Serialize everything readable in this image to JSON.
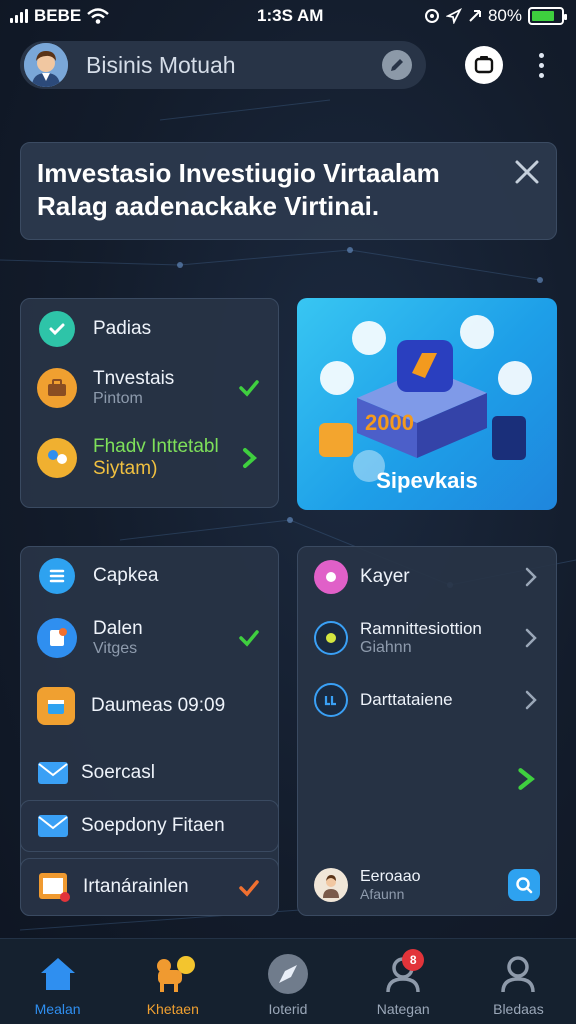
{
  "status_bar": {
    "carrier": "BEBE",
    "time": "1:3S AM",
    "battery": "80%",
    "battery_level": 0.8
  },
  "profile": {
    "name": "Bisinis Motuah"
  },
  "banner": {
    "line1": "Imvestasio Investiugio Virtaalam",
    "line2": "Ralag aadenackake Virtinai."
  },
  "top_card": {
    "items": [
      {
        "title": "Padias",
        "subtitle": ""
      },
      {
        "title": "Tnvestais",
        "subtitle": "Pintom"
      },
      {
        "title": "Fhadv Inttetabl",
        "subtitle": "Siytam)"
      }
    ]
  },
  "promo": {
    "number": "2000",
    "label": "Sipevkais"
  },
  "left_card": {
    "items": [
      {
        "title": "Capkea",
        "subtitle": ""
      },
      {
        "title": "Dalen",
        "subtitle": "Vitges"
      },
      {
        "title": "Daumeas 09:09",
        "subtitle": ""
      },
      {
        "title": "Soercasl",
        "subtitle": ""
      }
    ],
    "sub_items": [
      {
        "title": "Soepdony Fitaen"
      },
      {
        "title": "Irtanárainlen"
      }
    ]
  },
  "right_card": {
    "items": [
      {
        "title": "Kayer",
        "subtitle": ""
      },
      {
        "title": "Ramnittesiottion",
        "subtitle": "Giahnn"
      },
      {
        "title": "Darttataiene",
        "subtitle": ""
      }
    ],
    "footer": {
      "title": "Eeroaao",
      "subtitle": "Afaunn"
    }
  },
  "bottom_nav": {
    "items": [
      {
        "label": "Mealan",
        "color": "#2f8ff0"
      },
      {
        "label": "Khetaen",
        "color": "#f0a030"
      },
      {
        "label": "Ioterid",
        "color": "#8e9aaa"
      },
      {
        "label": "Nategan",
        "color": "#8e9aaa",
        "badge": "8"
      },
      {
        "label": "Bledaas",
        "color": "#8e9aaa"
      }
    ]
  },
  "colors": {
    "accent": "#2f8ff0",
    "check_green": "#3fcf3f",
    "check_orange": "#f07030",
    "background": "#131c2b"
  }
}
